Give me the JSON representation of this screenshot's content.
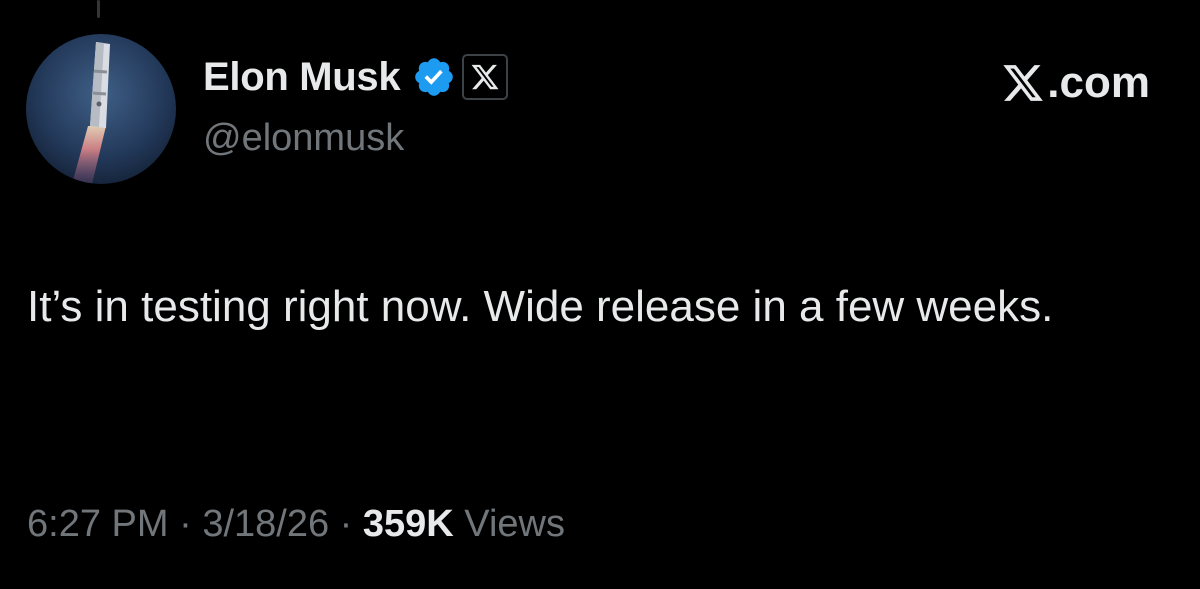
{
  "author": {
    "display_name": "Elon Musk",
    "handle": "@elonmusk",
    "verified_icon": "verified-badge-icon",
    "affiliate_icon": "x-logo-icon",
    "avatar": "rocket-launch-avatar"
  },
  "brand": {
    "text": ".com",
    "logo_icon": "x-logo-icon"
  },
  "tweet": {
    "text": "It’s in testing right now. Wide release in a few weeks.",
    "time": "6:27 PM",
    "separator": " · ",
    "date": "3/18/26",
    "views_count": "359K",
    "views_label": "Views"
  },
  "colors": {
    "background": "#000000",
    "text_primary": "#e7e9ea",
    "text_secondary": "#71767b",
    "verified_blue": "#1d9bf0"
  }
}
